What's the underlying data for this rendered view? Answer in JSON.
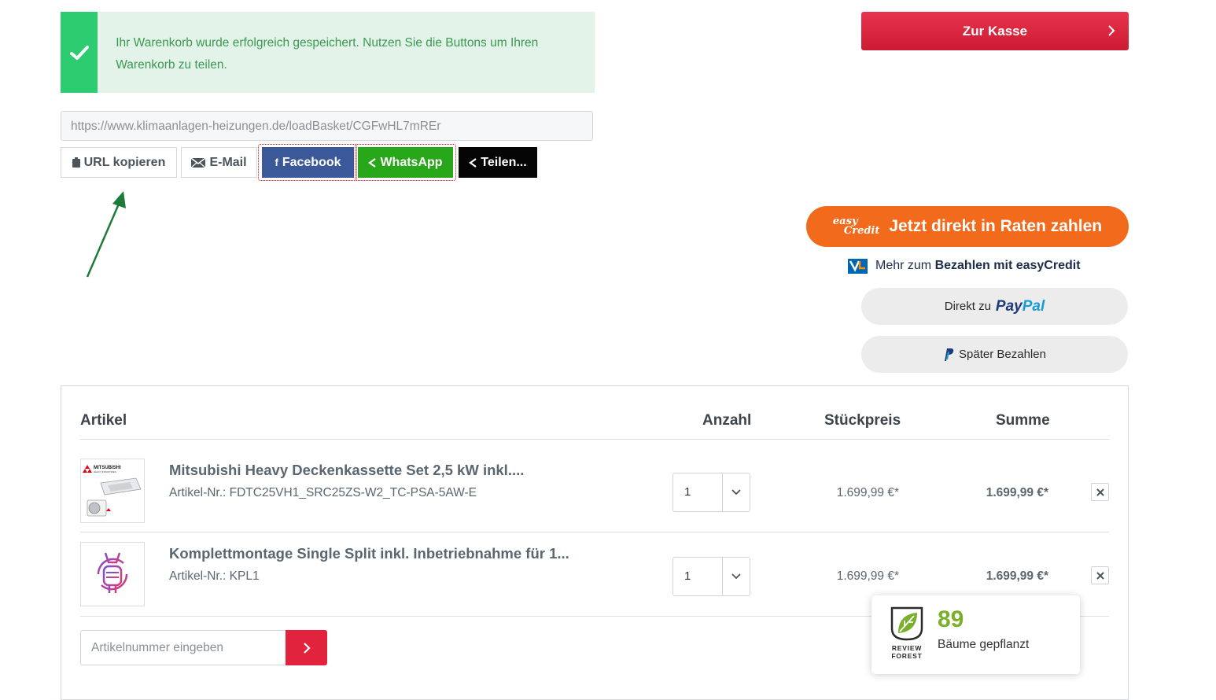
{
  "alert": {
    "text": "Ihr Warenkorb wurde erfolgreich gespeichert. Nutzen Sie die Buttons um Ihren Warenkorb zu teilen.",
    "icon": "checkmark-icon",
    "color": "#2ecc71"
  },
  "share": {
    "url": "https://www.klimaanlagen-heizungen.de/loadBasket/CGFwHL7mREr",
    "copy_label": "URL kopieren",
    "mail_label": "E-Mail",
    "facebook_label": "Facebook",
    "whatsapp_label": "WhatsApp",
    "share_label": "Teilen..."
  },
  "checkout": {
    "button_label": "Zur Kasse",
    "color": "#e2233e"
  },
  "payment": {
    "easycredit_logo_top": "easy",
    "easycredit_logo_bottom": "Credit",
    "easycredit_label": "Jetzt direkt in Raten zahlen",
    "easycredit_info_prefix": "Mehr zum",
    "easycredit_info_bold": "Bezahlen mit easyCredit",
    "paypal_prefix": "Direkt zu",
    "paypal_brand_pay": "Pay",
    "paypal_brand_pal": "Pal",
    "paypal_later_label": "Später Bezahlen",
    "easycredit_color": "#f26a1b"
  },
  "cart": {
    "headers": {
      "article": "Artikel",
      "quantity": "Anzahl",
      "unit_price": "Stückpreis",
      "total": "Summe"
    },
    "items": [
      {
        "title": "Mitsubishi Heavy Deckenkassette Set 2,5 kW inkl....",
        "article_nr": "Artikel-Nr.: FDTC25VH1_SRC25ZS-W2_TC-PSA-5AW-E",
        "quantity": "1",
        "unit_price": "1.699,99 €*",
        "total": "1.699,99 €*",
        "brand_text": "MITSUBISHI",
        "brand_subtext": "HEAVY INDUSTRIES"
      },
      {
        "title": "Komplettmontage Single Split inkl. Inbetriebnahme für 1...",
        "article_nr": "Artikel-Nr.: KPL1",
        "quantity": "1",
        "unit_price": "1.699,99 €*",
        "total": "1.699,99 €*"
      }
    ],
    "article_input_placeholder": "Artikelnummer eingeben"
  },
  "review_forest": {
    "count": "89",
    "label": "Bäume gepflanzt",
    "logo_text_top": "REVIEW",
    "logo_text_bottom": "FOREST"
  }
}
